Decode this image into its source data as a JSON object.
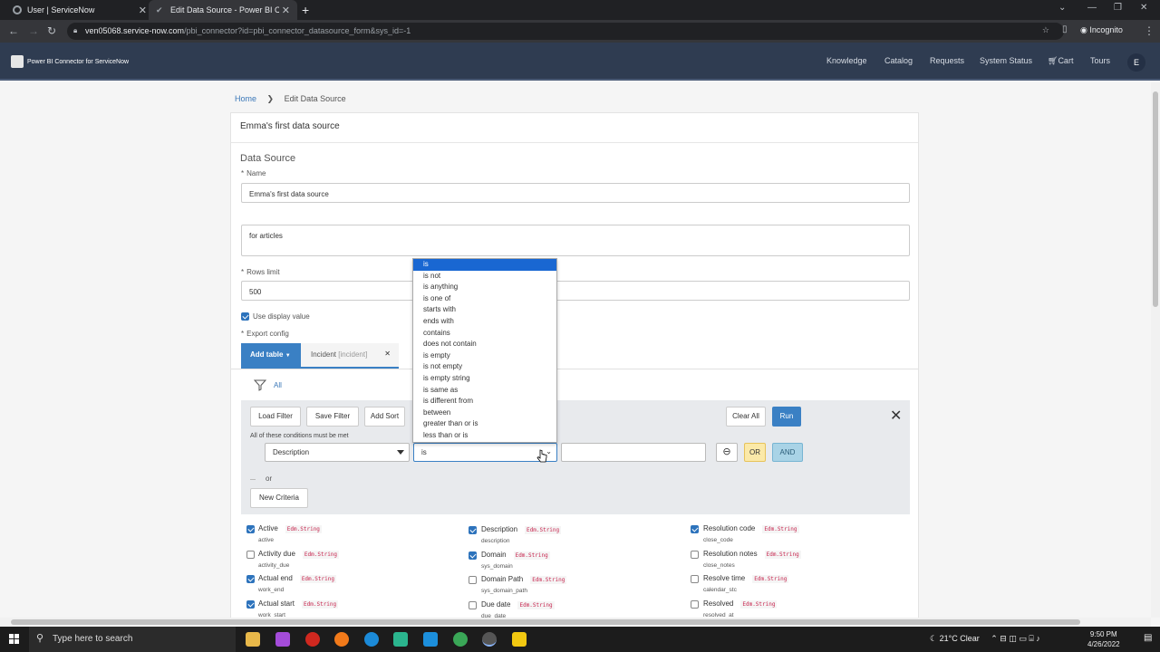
{
  "browser": {
    "tabs": [
      {
        "label": "User | ServiceNow"
      },
      {
        "label": "Edit Data Source - Power BI Conn"
      }
    ],
    "url_host": "ven05068.service-now.com",
    "url_path": "/pbi_connector?id=pbi_connector_datasource_form&sys_id=-1",
    "incognito_label": "Incognito"
  },
  "header": {
    "app_name": "Power BI Connector for ServiceNow",
    "nav": [
      "Knowledge",
      "Catalog",
      "Requests",
      "System Status",
      "Cart",
      "Tours"
    ],
    "avatar": "E"
  },
  "breadcrumb": {
    "home": "Home",
    "current": "Edit Data Source"
  },
  "form": {
    "card_title": "Emma's first data source",
    "section_title": "Data Source",
    "name_label": "Name",
    "name_value": "Emma's first data source",
    "description_value": "for articles",
    "rows_limit_label": "Rows limit",
    "rows_limit_value": "500",
    "use_display_value_label": "Use display value",
    "use_display_value_checked": true,
    "export_config_label": "Export config",
    "add_table_label": "Add table",
    "table_tab": {
      "label": "Incident",
      "name": "[incident]"
    }
  },
  "filter": {
    "all_label": "All",
    "buttons": {
      "load": "Load Filter",
      "save": "Save Filter",
      "sort": "Add Sort",
      "clear": "Clear All",
      "run": "Run"
    },
    "conditions_text": "All of these conditions must be met",
    "field_value": "Description",
    "operator_value": "is",
    "or_button": "OR",
    "and_button": "AND",
    "or_separator": "or",
    "new_criteria": "New Criteria"
  },
  "operator_options": [
    "is",
    "is not",
    "is anything",
    "is one of",
    "starts with",
    "ends with",
    "contains",
    "does not contain",
    "is empty",
    "is not empty",
    "is empty string",
    "is same as",
    "is different from",
    "between",
    "greater than or is",
    "less than or is"
  ],
  "columns": [
    [
      {
        "label": "Active",
        "type": "Edm.String",
        "field": "active",
        "checked": true
      },
      {
        "label": "Activity due",
        "type": "Edm.String",
        "field": "activity_due",
        "checked": false
      },
      {
        "label": "Actual end",
        "type": "Edm.String",
        "field": "work_end",
        "checked": true
      },
      {
        "label": "Actual start",
        "type": "Edm.String",
        "field": "work_start",
        "checked": true
      }
    ],
    [
      {
        "label": "Description",
        "type": "Edm.String",
        "field": "description",
        "checked": true
      },
      {
        "label": "Domain",
        "type": "Edm.String",
        "field": "sys_domain",
        "checked": true
      },
      {
        "label": "Domain Path",
        "type": "Edm.String",
        "field": "sys_domain_path",
        "checked": false
      },
      {
        "label": "Due date",
        "type": "Edm.String",
        "field": "due_date",
        "checked": false
      }
    ],
    [
      {
        "label": "Resolution code",
        "type": "Edm.String",
        "field": "close_code",
        "checked": true
      },
      {
        "label": "Resolution notes",
        "type": "Edm.String",
        "field": "close_notes",
        "checked": false
      },
      {
        "label": "Resolve time",
        "type": "Edm.String",
        "field": "calendar_stc",
        "checked": false
      },
      {
        "label": "Resolved",
        "type": "Edm.String",
        "field": "resolved_at",
        "checked": false
      }
    ]
  ],
  "taskbar": {
    "search_placeholder": "Type here to search",
    "weather": "21°C  Clear",
    "time": "9:50 PM",
    "date": "4/26/2022"
  }
}
